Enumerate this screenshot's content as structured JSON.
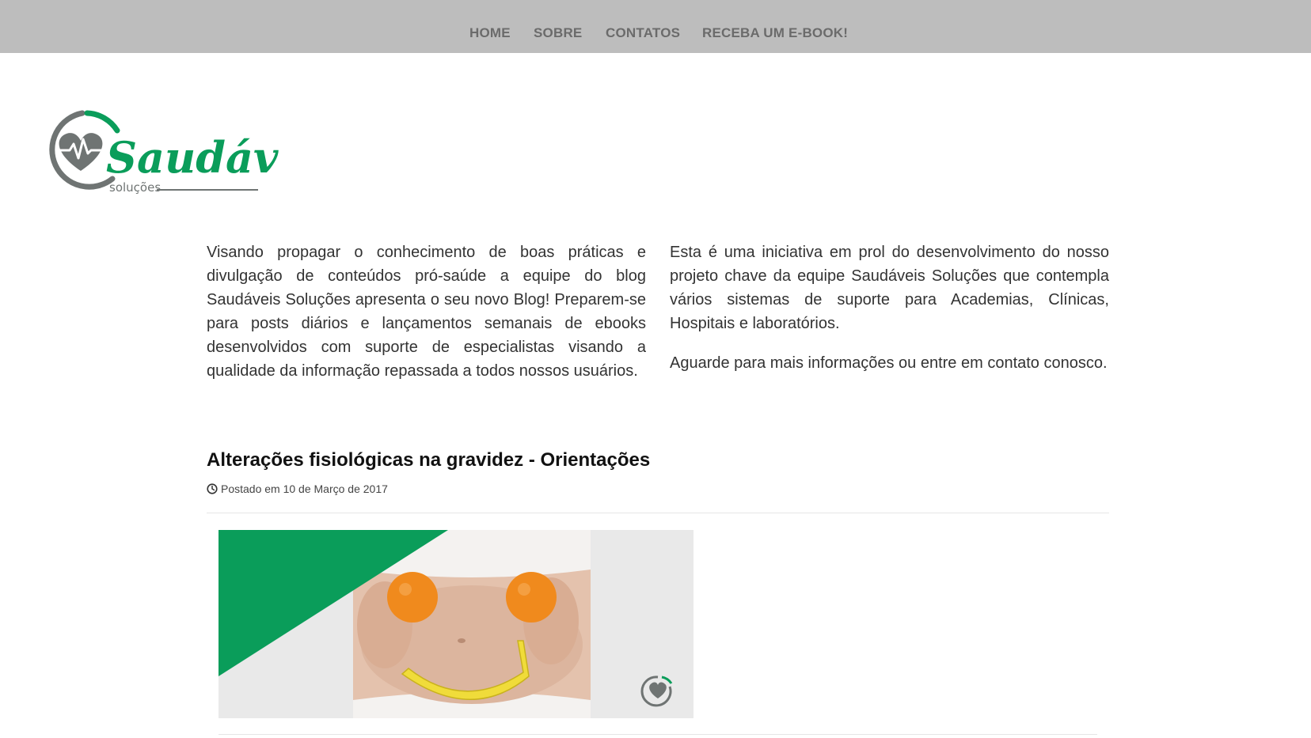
{
  "nav": {
    "items": [
      {
        "label": "HOME"
      },
      {
        "label": "SOBRE"
      },
      {
        "label": "CONTATOS"
      },
      {
        "label": "RECEBA UM E-BOOK!"
      }
    ]
  },
  "logo": {
    "name": "Saudáveis",
    "tagline": "soluções",
    "icon": "heart-pulse-icon"
  },
  "intro": {
    "left_paragraph": "Visando propagar o conhecimento de boas práticas e divulgação de conteúdos pró-saúde a equipe do blog Saudáveis Soluções apresenta o seu novo Blog! Preparem-se para posts diários e lançamentos semanais de ebooks desenvolvidos com suporte de especialistas visando a qualidade da informação repassada a todos nossos usuários.",
    "right_paragraph_1": "Esta é uma iniciativa em prol do desenvolvimento do nosso projeto chave da equipe Saudáveis Soluções que contempla vários sistemas de suporte para Academias, Clínicas, Hospitais e laboratórios.",
    "right_paragraph_2": "Aguarde para mais informações ou entre em contato conosco."
  },
  "post": {
    "title": "Alterações fisiológicas na gravidez - Orientações",
    "meta": "Postado em 10 de Março de 2017",
    "meta_icon": "clock-icon"
  },
  "colors": {
    "brand_green": "#0a9d5a",
    "brand_gray": "#6f7473",
    "nav_bg": "#bdbdbd",
    "nav_text": "#6b6b6b"
  }
}
